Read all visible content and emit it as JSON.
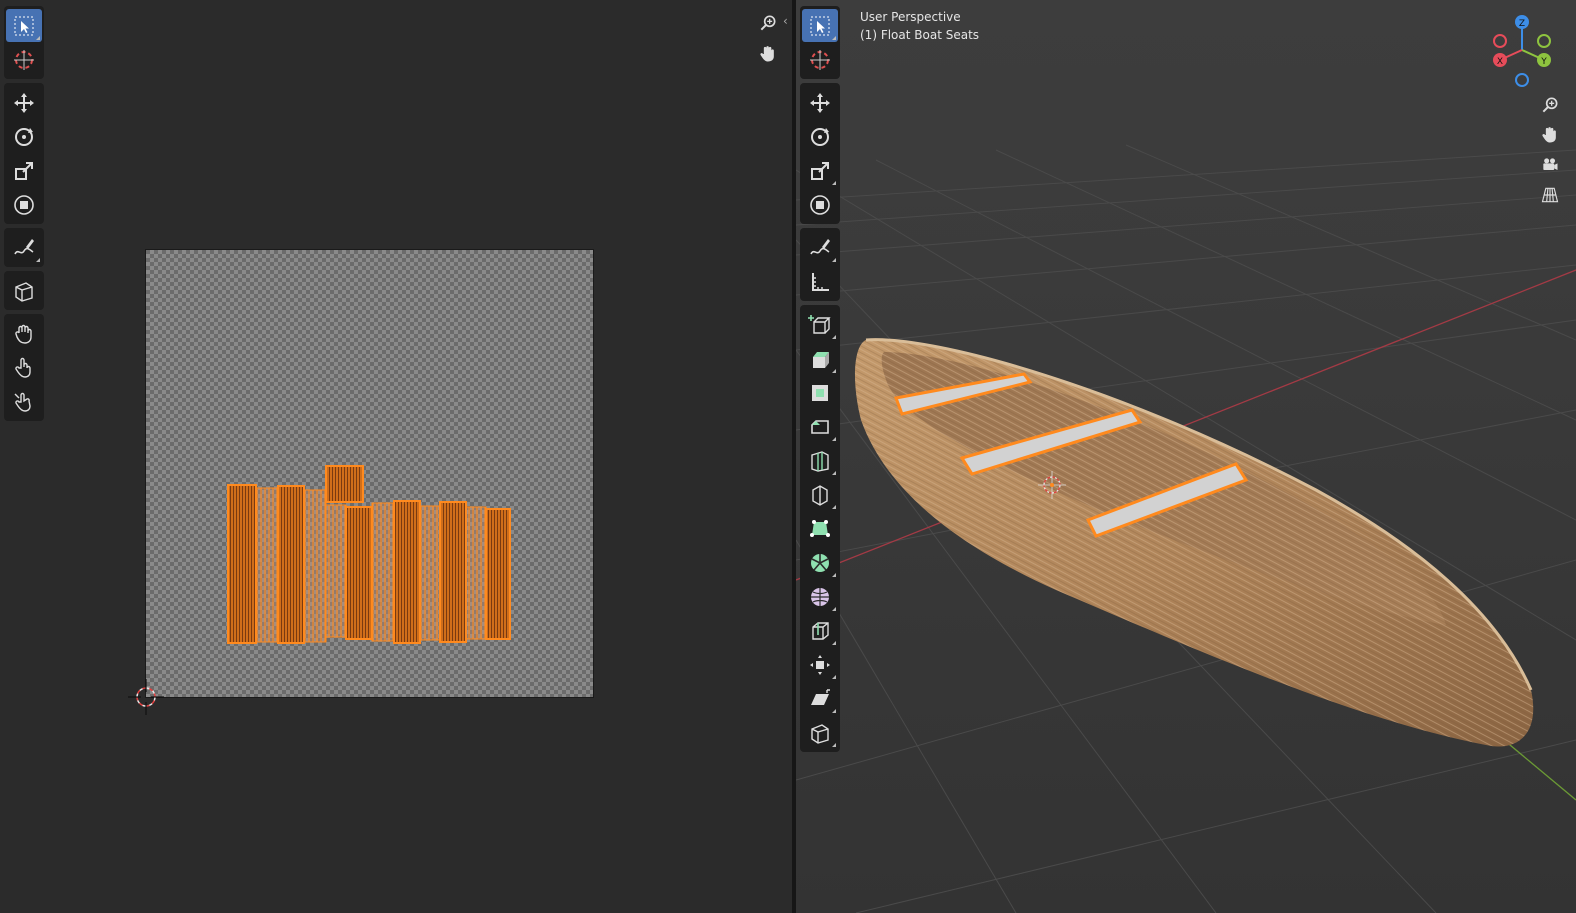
{
  "uv_editor": {
    "tools": [
      "select-box",
      "cursor",
      "move",
      "rotate",
      "scale",
      "transform",
      "annotate",
      "rip-region",
      "grab",
      "relax",
      "pinch"
    ],
    "nav": [
      "zoom-icon",
      "hand-icon"
    ],
    "collapse_arrow": "‹"
  },
  "viewport": {
    "view_name": "User Perspective",
    "object_label": "(1) Float Boat Seats",
    "tools": [
      "select-box",
      "cursor",
      "move",
      "rotate",
      "scale",
      "transform",
      "annotate",
      "measure",
      "add-cube",
      "extrude-region",
      "inset-faces",
      "bevel",
      "loop-cut",
      "knife",
      "poly-build",
      "spin",
      "smooth",
      "edge-slide",
      "shrink-fatten",
      "shear",
      "rip-region"
    ],
    "gizmo": {
      "z": "Z",
      "y": "Y",
      "x": "X"
    },
    "nav": [
      "zoom-icon",
      "hand-icon",
      "camera-icon",
      "grid-icon"
    ]
  },
  "colors": {
    "accent": "#4772b3",
    "selection_orange": "#ff8a1e",
    "axis_x": "#e74c5a",
    "axis_y": "#8ec43f",
    "axis_z": "#3d8ee8",
    "wood": "#b98a5f"
  }
}
